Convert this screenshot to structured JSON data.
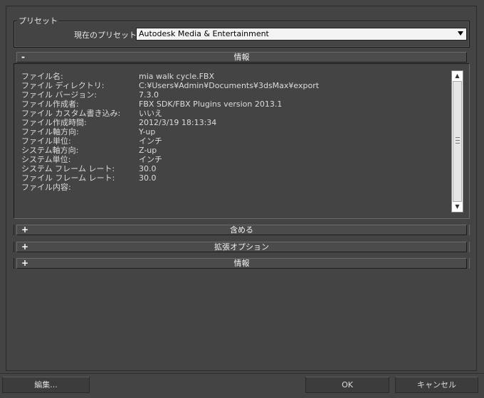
{
  "preset": {
    "legend": "プリセット",
    "label": "現在のプリセット:",
    "selected": "Autodesk Media & Entertainment"
  },
  "info_rollout": {
    "toggle": "-",
    "title": "情報",
    "rows": [
      {
        "key": "ファイル名:",
        "value": "mia walk cycle.FBX"
      },
      {
        "key": "ファイル ディレクトリ:",
        "value": "C:¥Users¥Admin¥Documents¥3dsMax¥export"
      },
      {
        "key": "ファイル バージョン:",
        "value": "7.3.0"
      },
      {
        "key": "ファイル作成者:",
        "value": "FBX SDK/FBX Plugins version 2013.1"
      },
      {
        "key": "ファイル カスタム書き込み:",
        "value": "いいえ"
      },
      {
        "key": "ファイル作成時間:",
        "value": "2012/3/19  18:13:34"
      },
      {
        "key": "ファイル軸方向:",
        "value": "Y-up"
      },
      {
        "key": "ファイル単位:",
        "value": "インチ"
      },
      {
        "key": "システム軸方向:",
        "value": "Z-up"
      },
      {
        "key": "システム単位:",
        "value": "インチ"
      },
      {
        "key": "システム フレーム レート:",
        "value": "30.0"
      },
      {
        "key": "ファイル フレーム レート:",
        "value": "30.0"
      },
      {
        "key": "ファイル内容:",
        "value": ""
      }
    ]
  },
  "include_rollout": {
    "toggle": "+",
    "title": "含める"
  },
  "advanced_rollout": {
    "toggle": "+",
    "title": "拡張オプション"
  },
  "info2_rollout": {
    "toggle": "+",
    "title": "情報"
  },
  "buttons": {
    "edit": "編集...",
    "ok": "OK",
    "cancel": "キャンセル"
  },
  "icons": {
    "scroll_up": "▲",
    "scroll_down": "▼",
    "dropdown": "chevron-down-icon"
  }
}
